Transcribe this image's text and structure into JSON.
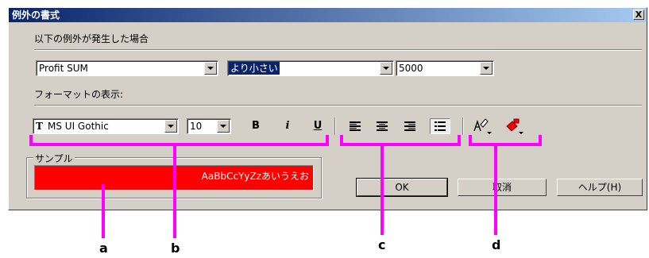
{
  "dialog": {
    "title": "例外の書式",
    "close_glyph": "X",
    "condition_label": "以下の例外が発生した場合",
    "field_value": "Profit SUM",
    "operator_value": "より小さい",
    "threshold_value": "5000",
    "format_label": "フォーマットの表示:",
    "font_family_value": "MS UI Gothic",
    "font_type_glyph": "T",
    "font_size_value": "10",
    "bold_label": "B",
    "italic_label": "i",
    "underline_label": "U",
    "align_left_icon": "align-left-icon",
    "align_center_icon": "align-center-icon",
    "align_right_icon": "align-right-icon",
    "align_justify_icon": "align-justify-icon",
    "text_color_icon": "text-color-icon",
    "fill_color_icon": "fill-color-icon",
    "sample_legend": "サンプル",
    "sample_text": "AaBbCcYyZzあいうえお",
    "ok_label": "OK",
    "cancel_label": "取消",
    "help_label": "ヘルプ(H)",
    "sample_bg_color": "#ff0000",
    "highlight_color": "#ff00ff"
  },
  "callouts": {
    "a": "a",
    "b": "b",
    "c": "c",
    "d": "d"
  }
}
